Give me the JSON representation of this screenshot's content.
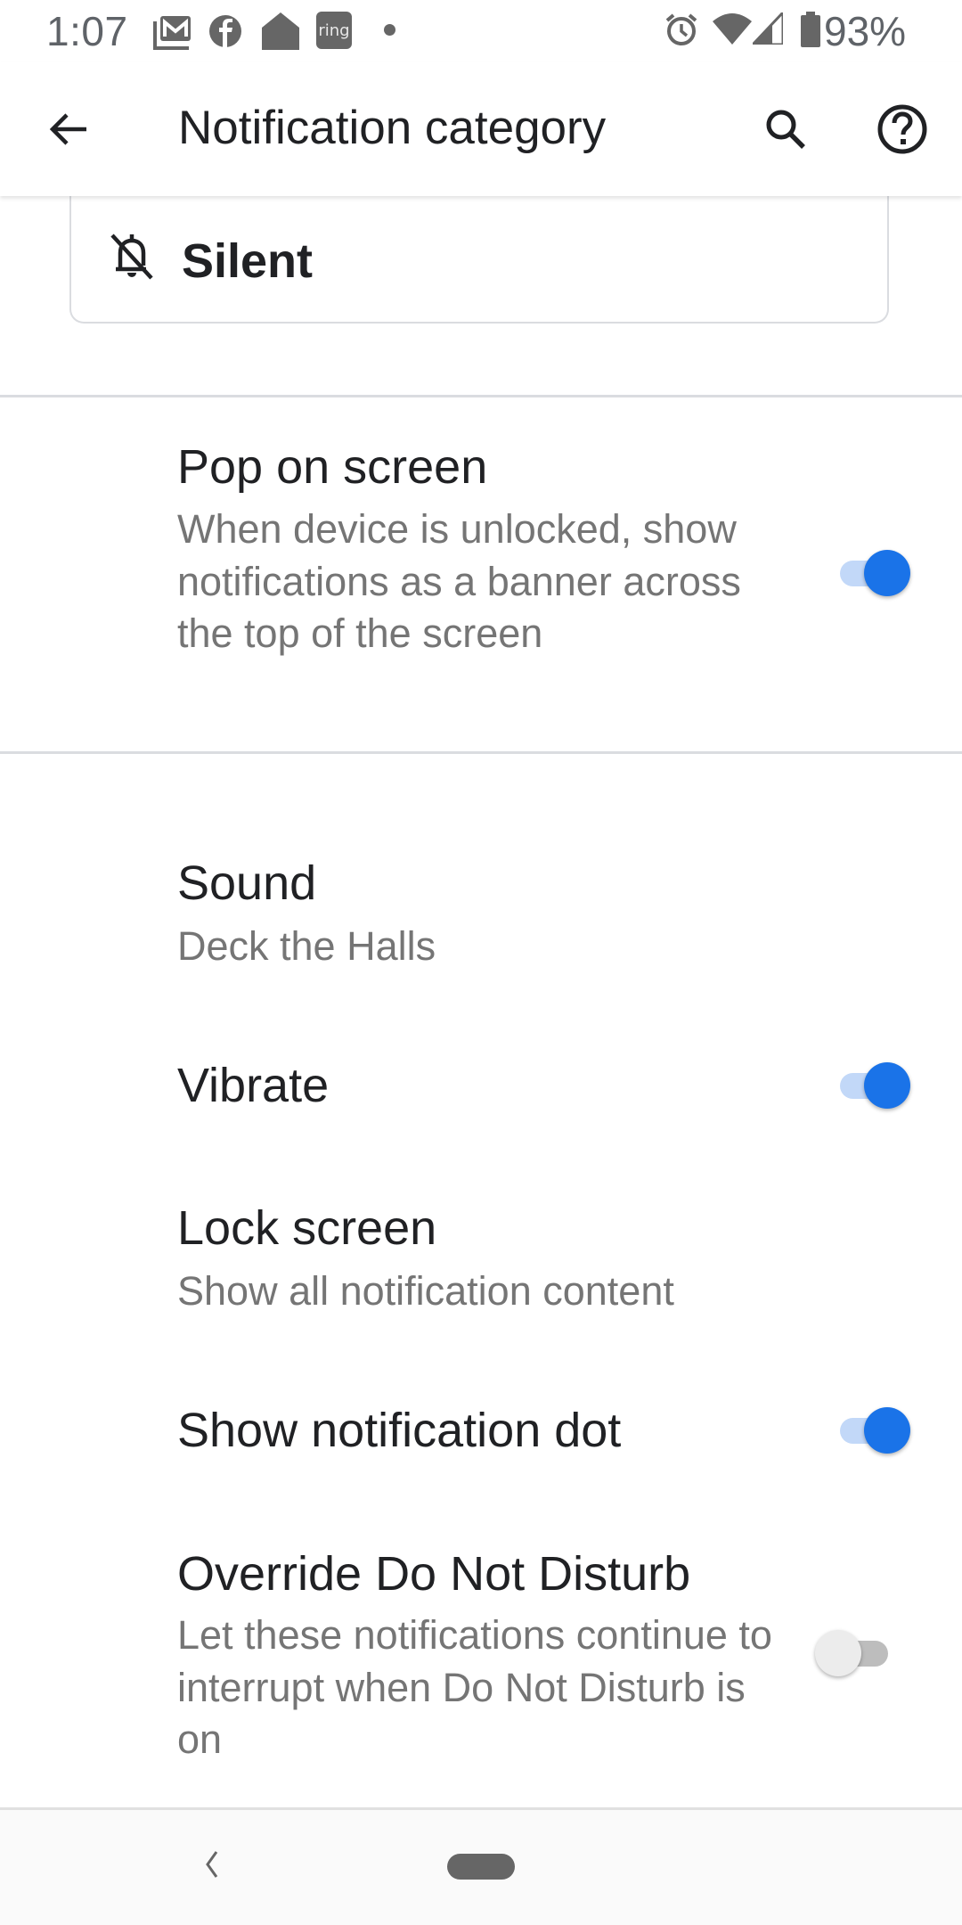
{
  "status_bar": {
    "time": "1:07",
    "notification_icons": [
      "gmail-icon",
      "facebook-icon",
      "google-home-icon",
      "ring-icon",
      "more-dot-icon"
    ],
    "ring_label": "ring",
    "system_icons": [
      "alarm-icon",
      "wifi-icon",
      "cell-signal-icon",
      "battery-icon"
    ],
    "battery_percent": "93%"
  },
  "app_bar": {
    "title": "Notification category",
    "back_icon": "arrow-back-icon",
    "search_icon": "search-icon",
    "help_icon": "help-icon"
  },
  "importance": {
    "selected_label": "Silent",
    "icon": "bell-off-icon"
  },
  "preferences": [
    {
      "title": "Pop on screen",
      "summary": "When device is unlocked, show notifications as a banner across the top of the screen",
      "toggle": true
    },
    {
      "title": "Sound",
      "summary": "Deck the Halls"
    },
    {
      "title": "Vibrate",
      "toggle": true
    },
    {
      "title": "Lock screen",
      "summary": "Show all notification content"
    },
    {
      "title": "Show notification dot",
      "toggle": true
    },
    {
      "title": "Override Do Not Disturb",
      "summary": "Let these notifications continue to interrupt when Do Not Disturb is on",
      "toggle": false
    }
  ],
  "colors": {
    "accent": "#1a73e8",
    "accent_track": "#c2d8f8",
    "primary_text": "#202124",
    "secondary_text": "#757575",
    "divider": "#dadce0"
  },
  "nav_bar": {
    "back_icon": "nav-back-icon",
    "home_icon": "home-pill-icon"
  }
}
